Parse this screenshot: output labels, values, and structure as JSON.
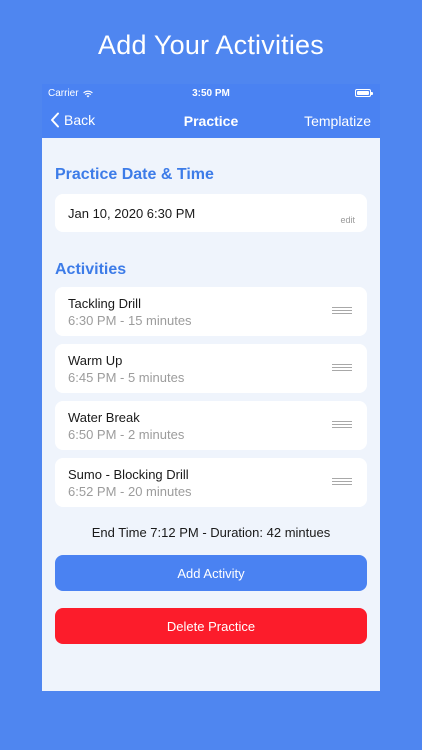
{
  "promo": {
    "title": "Add Your Activities"
  },
  "status_bar": {
    "carrier": "Carrier",
    "time": "3:50 PM"
  },
  "nav": {
    "back_label": "Back",
    "title": "Practice",
    "right_label": "Templatize"
  },
  "date_section": {
    "title": "Practice Date & Time",
    "value": "Jan 10, 2020 6:30 PM",
    "edit_label": "edit"
  },
  "activities_section": {
    "title": "Activities",
    "items": [
      {
        "name": "Tackling Drill",
        "detail": "6:30 PM - 15 minutes"
      },
      {
        "name": "Warm Up",
        "detail": "6:45 PM - 5 minutes"
      },
      {
        "name": "Water Break",
        "detail": "6:50 PM - 2 minutes"
      },
      {
        "name": "Sumo - Blocking Drill",
        "detail": "6:52 PM - 20 minutes"
      }
    ]
  },
  "summary": "End Time 7:12 PM - Duration: 42 mintues",
  "buttons": {
    "add_activity": "Add Activity",
    "delete_practice": "Delete Practice"
  },
  "colors": {
    "background": "#4f86f0",
    "accent": "#4a82f2",
    "section_title": "#3d7ce8",
    "danger": "#fc1c2b",
    "screen_bg": "#eff4fc"
  }
}
